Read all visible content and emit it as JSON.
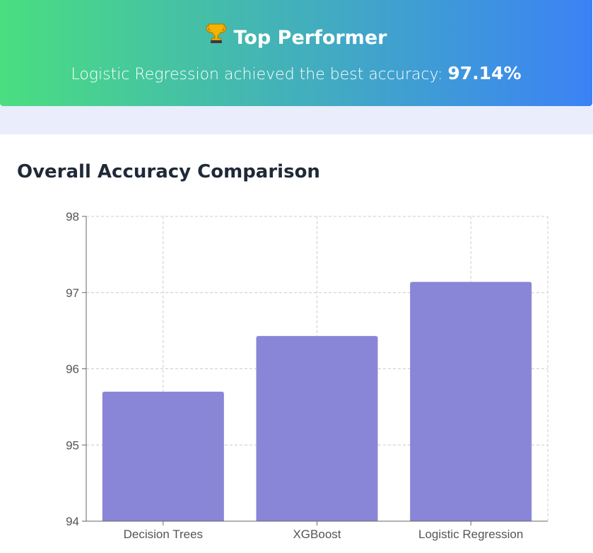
{
  "banner": {
    "icon": "trophy-icon",
    "title": "Top Performer",
    "subtitle_prefix": "Logistic Regression achieved the best accuracy: ",
    "accuracy": "97.14%",
    "gradient_start": "#4ade80",
    "gradient_end": "#3b82f6"
  },
  "section": {
    "title": "Overall Accuracy Comparison"
  },
  "chart_data": {
    "type": "bar",
    "categories": [
      "Decision Trees",
      "XGBoost",
      "Logistic Regression"
    ],
    "values": [
      95.7,
      96.43,
      97.14
    ],
    "ylim": [
      94,
      98
    ],
    "yticks": [
      "94",
      "95",
      "96",
      "97",
      "98"
    ],
    "grid": true,
    "bar_color": "#8986d8",
    "title": "",
    "xlabel": "",
    "ylabel": ""
  }
}
